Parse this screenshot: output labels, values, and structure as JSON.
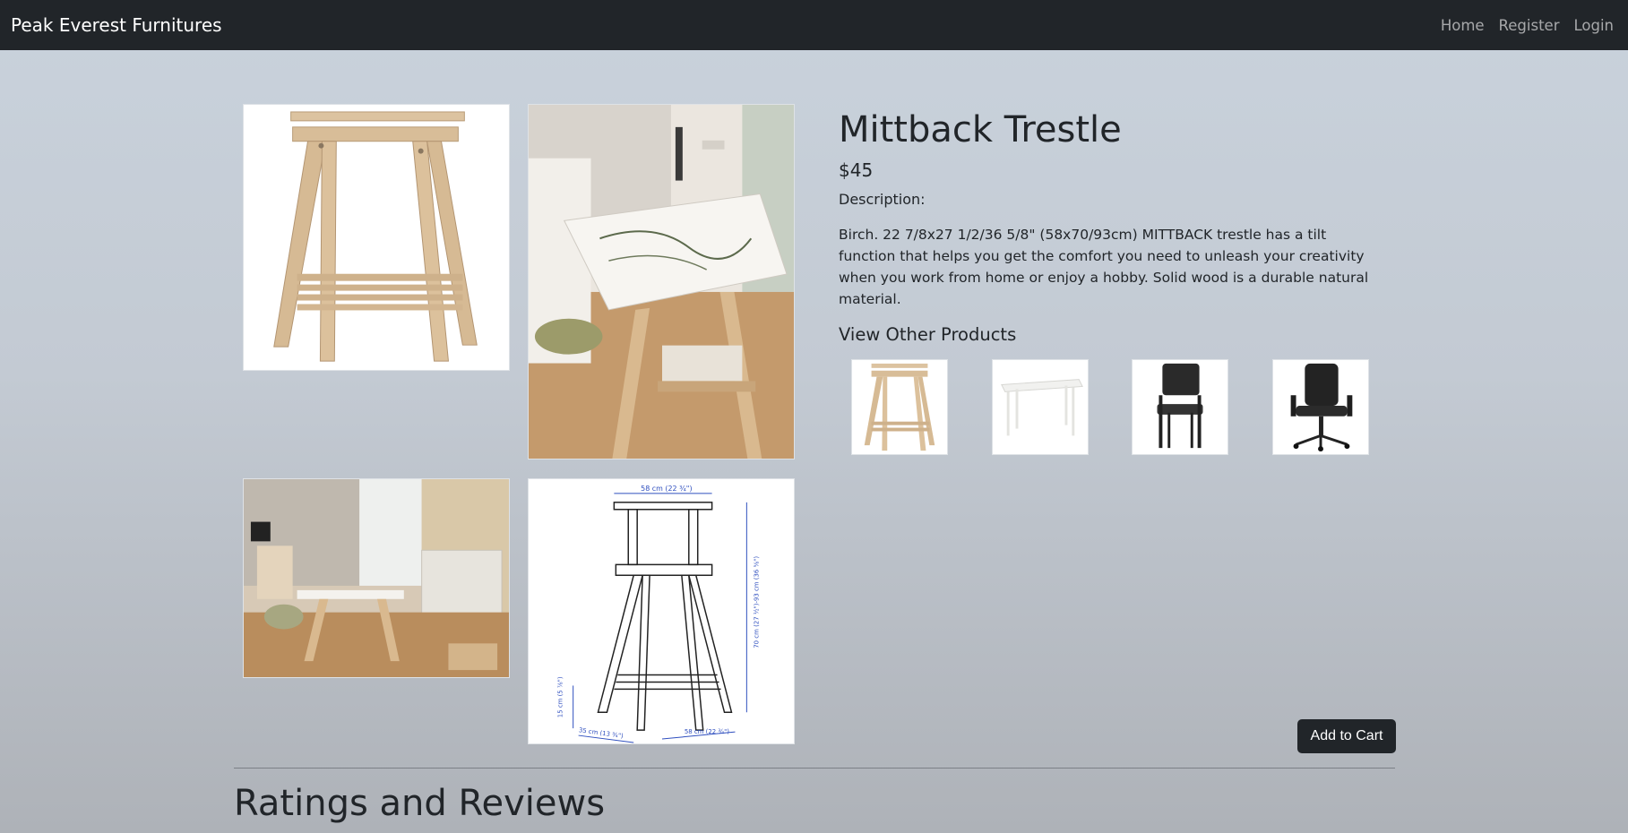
{
  "navbar": {
    "brand": "Peak Everest Furnitures",
    "links": [
      "Home",
      "Register",
      "Login"
    ]
  },
  "gallery": {
    "images": [
      "trestle-product-image",
      "trestle-desk-lifestyle-image",
      "workspace-room-image",
      "trestle-dimensions-diagram"
    ],
    "dimension_labels": [
      "58 cm (22 ¾\")",
      "70 cm (27 ½\")-93 cm (36 ⅝\")",
      "15 cm (5 ⅞\")",
      "35 cm (13 ¾\")",
      "58 cm (22 ¾\")"
    ]
  },
  "product": {
    "title": "Mittback Trestle",
    "price": "$45",
    "description_label": "Description:",
    "description": "Birch. 22 7/8x27 1/2/36 5/8\" (58x70/93cm) MITTBACK trestle has a tilt function that helps you get the comfort you need to unleash your creativity when you work from home or enjoy a hobby. Solid wood is a durable natural material."
  },
  "other_products": {
    "heading": "View Other Products",
    "items": [
      "trestle-thumbnail",
      "white-desk-thumbnail",
      "black-chair-thumbnail",
      "office-chair-thumbnail"
    ]
  },
  "actions": {
    "add_to_cart": "Add to Cart"
  },
  "reviews": {
    "heading": "Ratings and Reviews"
  },
  "colors": {
    "navbar_bg": "#212529",
    "button_bg": "#212529",
    "wood": "#d8bf9c"
  }
}
